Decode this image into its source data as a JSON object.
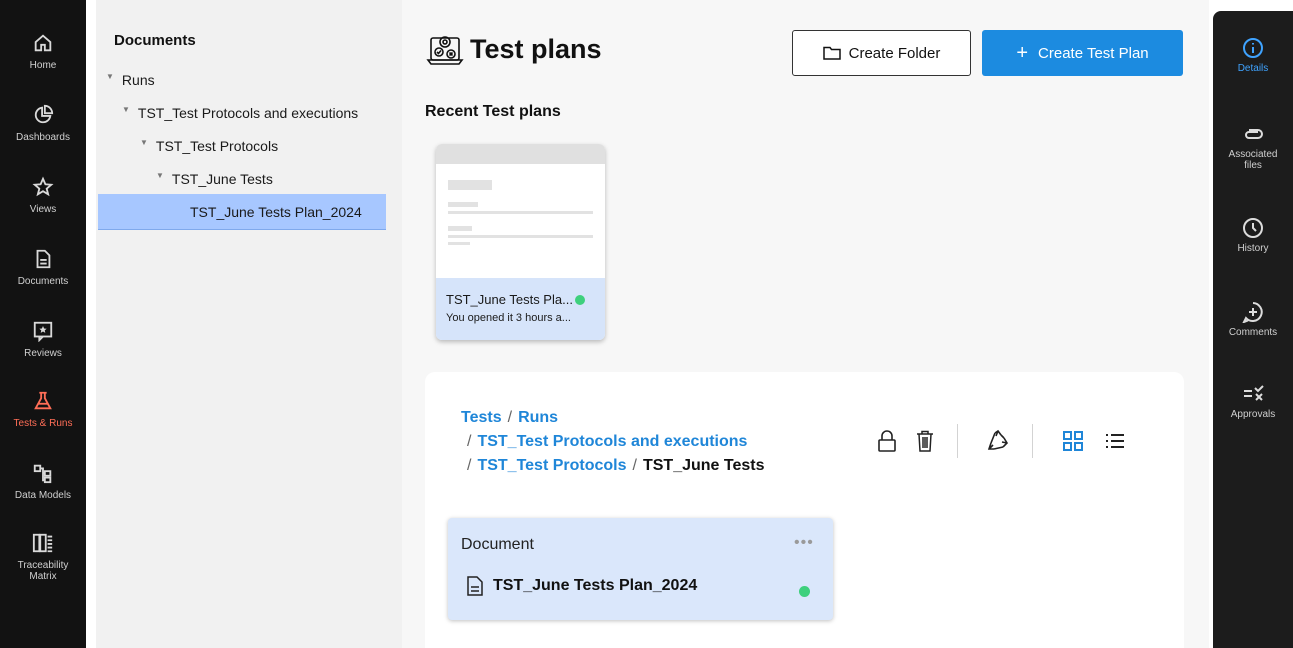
{
  "nav": {
    "items": [
      {
        "icon": "home-icon",
        "label": "Home"
      },
      {
        "icon": "dashboards-icon",
        "label": "Dashboards"
      },
      {
        "icon": "star-icon",
        "label": "Views"
      },
      {
        "icon": "document-icon",
        "label": "Documents"
      },
      {
        "icon": "review-star-icon",
        "label": "Reviews"
      },
      {
        "icon": "flask-icon",
        "label": "Tests & Runs"
      },
      {
        "icon": "data-model-icon",
        "label": "Data Models"
      },
      {
        "icon": "matrix-icon",
        "label": "Traceability Matrix"
      }
    ],
    "active_color": "#ff6e57"
  },
  "tree": {
    "title": "Documents",
    "items": [
      {
        "label": "Runs"
      },
      {
        "label": "TST_Test Protocols and executions"
      },
      {
        "label": "TST_Test Protocols"
      },
      {
        "label": "TST_June Tests"
      },
      {
        "label": "TST_June Tests Plan_2024"
      }
    ]
  },
  "main": {
    "title": "Test plans",
    "create_folder_label": "Create Folder",
    "create_plan_label": "Create Test Plan",
    "recent_label": "Recent Test plans",
    "recent_card": {
      "name": "TST_June Tests Pla...",
      "subtitle": "You opened it 3 hours a..."
    },
    "breadcrumb": {
      "root": "Tests",
      "runs": "Runs",
      "protocols_exec": "TST_Test Protocols and executions",
      "protocols": "TST_Test Protocols",
      "current": "TST_June Tests",
      "separator": "/"
    },
    "document_card": {
      "header": "Document",
      "more": "•••",
      "name": "TST_June Tests Plan_2024"
    }
  },
  "rightrail": {
    "items": [
      {
        "icon": "info-icon",
        "label": "Details"
      },
      {
        "icon": "paperclip-icon",
        "label": "Associated files"
      },
      {
        "icon": "clock-icon",
        "label": "History"
      },
      {
        "icon": "comment-add-icon",
        "label": "Comments"
      },
      {
        "icon": "approvals-icon",
        "label": "Approvals"
      }
    ],
    "active_color": "#3fa3ff"
  },
  "colors": {
    "primary": "#1c8be0",
    "link": "#1f86d8",
    "status_green": "#3ed07d",
    "selection": "#a7c7ff"
  }
}
